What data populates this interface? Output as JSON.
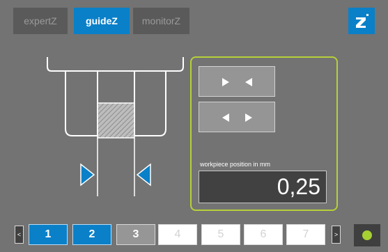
{
  "tabs": [
    {
      "label": "expertZ",
      "active": false
    },
    {
      "label": "guideZ",
      "active": true
    },
    {
      "label": "monitorZ",
      "active": false
    }
  ],
  "logo": {
    "icon": "z-logo-icon",
    "color": "#0a80c8"
  },
  "panel": {
    "close_button_icon": "arrows-inward-icon",
    "open_button_icon": "arrows-outward-icon",
    "position_label": "workpiece position in mm",
    "position_value": "0,25"
  },
  "pager": {
    "prev_label": "<",
    "next_label": ">",
    "pages": [
      {
        "label": "1",
        "state": "done"
      },
      {
        "label": "2",
        "state": "done"
      },
      {
        "label": "3",
        "state": "current"
      },
      {
        "label": "4",
        "state": "todo"
      },
      {
        "label": "5",
        "state": "todo"
      },
      {
        "label": "6",
        "state": "todo"
      },
      {
        "label": "7",
        "state": "todo"
      }
    ]
  },
  "status": {
    "icon": "status-dot-icon",
    "color": "#a6d032"
  },
  "colors": {
    "accent": "#0a80c8",
    "panel_border": "#b6d039"
  }
}
